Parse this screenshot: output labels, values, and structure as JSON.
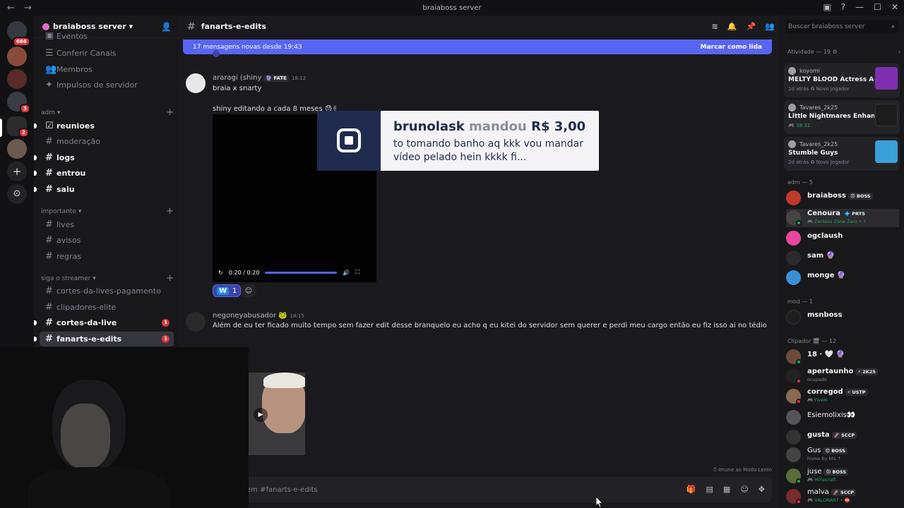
{
  "window": {
    "title": "braiaboss server",
    "back": "←",
    "forward": "→"
  },
  "guilds": {
    "home_badge": "666",
    "badges": [
      "3",
      "2"
    ],
    "add_icon": "+",
    "explore_icon": "⊙"
  },
  "server": {
    "name": "braiaboss server ▾"
  },
  "sidebar": {
    "top_items": [
      {
        "label": "Eventos",
        "icon": "▣"
      },
      {
        "label": "Conferir Canais",
        "icon": "☰"
      },
      {
        "label": "Membros",
        "icon": "👥"
      },
      {
        "label": "Impulsos de servidor",
        "icon": "✦"
      }
    ],
    "categories": [
      {
        "label": "adm ▾",
        "channels": [
          {
            "label": "reunioes",
            "icon": "☑",
            "bright": true
          },
          {
            "label": "moderação",
            "icon": "#",
            "bright": false
          },
          {
            "label": "logs",
            "icon": "#",
            "bright": true
          },
          {
            "label": "entrou",
            "icon": "#",
            "bright": true
          },
          {
            "label": "saiu",
            "icon": "#",
            "bright": true
          }
        ]
      },
      {
        "label": "importante ▾",
        "channels": [
          {
            "label": "lives",
            "icon": "#",
            "bright": false
          },
          {
            "label": "avisos",
            "icon": "#",
            "bright": false
          },
          {
            "label": "regras",
            "icon": "#",
            "bright": false
          }
        ]
      },
      {
        "label": "siga o streamer ▾",
        "channels": [
          {
            "label": "cortes-da-lives-pagamento",
            "icon": "#",
            "bright": false
          },
          {
            "label": "clipadores-elite",
            "icon": "#",
            "bright": false
          },
          {
            "label": "cortes-da-live",
            "icon": "#",
            "bright": true,
            "badge": "1"
          },
          {
            "label": "fanarts-e-edits",
            "icon": "#",
            "bright": true,
            "badge": "1",
            "active": true
          }
        ]
      }
    ]
  },
  "channel": {
    "name": "fanarts-e-edits",
    "hash": "#"
  },
  "banner": {
    "text": "17 mensagens novas desde 19:43",
    "mark": "Marcar como lida"
  },
  "messages": [
    {
      "author": "araragi (shiny",
      "tag": "🔮 FATE",
      "time": "18:12",
      "lines": [
        "braia x snarty",
        "shiny editando a cada 8 meses 😓✌"
      ],
      "video": {
        "time": "0:20 / 0:20",
        "progress": 1.0
      },
      "reaction": {
        "emoji": "W",
        "count": "1"
      }
    },
    {
      "author": "negoneyabusador",
      "tag": "🐸",
      "time": "18:15",
      "lines": [
        "Além de eu ter ficado muito tempo sem fazer edit desse branquelo eu acho q eu kitei do servidor sem querer e perdi meu cargo então eu fiz isso ai no tédio"
      ]
    }
  ],
  "donation": {
    "user": "brunolask",
    "verb": "mandou",
    "amount": "R$ 3,00",
    "message": "to tomando banho aq kkk vou mandar vídeo pelado hein kkkk fi..."
  },
  "input": {
    "placeholder": "em #fanarts-e-edits"
  },
  "immune": "Imune ao Modo Lento",
  "search": {
    "placeholder": "Buscar braiaboss server"
  },
  "activity": {
    "header": "Atividade — 19",
    "cards": [
      {
        "user": "koyomi",
        "game": "MELTY BLOOD Actress Ag...",
        "status": "1d atrás  ♻ Novo Jogador",
        "green": false,
        "art_color": "#7d2fb0"
      },
      {
        "user": "Tavares_2k25",
        "game": "Little Nightmares Enhance...",
        "status": "🎮 38:32",
        "green": true,
        "art_color": "#1c1c1c"
      },
      {
        "user": "Tavares_2k25",
        "game": "Stumble Guys",
        "status": "2d atrás  ♻ Novo Jogador",
        "green": false,
        "art_color": "#3aa0d8"
      }
    ]
  },
  "member_groups": [
    {
      "label": "adm — 5",
      "members": [
        {
          "name": "braiaboss",
          "tag": "😠 BOSS",
          "sub": "",
          "color": "#c0392b"
        },
        {
          "name": "Cenoura",
          "tag": "💠 PRTS",
          "sub": "🎮 Zenless Zone Zero • ⚡",
          "sub_green": true,
          "color": "#444"
        },
        {
          "name": "ogclaush",
          "tag": "",
          "sub": "",
          "color": "#eb459e"
        },
        {
          "name": "sam 🔮",
          "tag": "",
          "sub": "",
          "color": "#2b2b2b"
        },
        {
          "name": "monge 🔮",
          "tag": "",
          "sub": "",
          "color": "#3a8fd9"
        }
      ]
    },
    {
      "label": "mod — 1",
      "members": [
        {
          "name": "msnboss",
          "tag": "",
          "sub": "",
          "color": "#1e1e1e"
        }
      ]
    },
    {
      "label": "Clipador 🎬 — 12",
      "members": [
        {
          "name": "18 · 🤍 🔮",
          "tag": "",
          "sub": "",
          "color": "#6d4b3a"
        },
        {
          "name": "apertaunho",
          "tag": "⚡ 2K25",
          "sub": "ocupado",
          "color": "#222"
        },
        {
          "name": "corregod",
          "tag": "⚡ USTP",
          "sub": "🎮 FiveM",
          "sub_green": true,
          "color": "#8a6b52"
        },
        {
          "name": "Esiemolixis👀",
          "tag": "",
          "sub": "",
          "color": "#555"
        },
        {
          "name": "gusta",
          "tag": "🚀 SCCP",
          "sub": "",
          "color": "#333"
        },
        {
          "name": "Gus",
          "tag": "😠 BOSS",
          "sub": "home by bts ↑",
          "color": "#444"
        },
        {
          "name": "juse",
          "tag": "😠 BOSS",
          "sub": "🎮 Minecraft",
          "sub_green": true,
          "color": "#5b6c3a"
        },
        {
          "name": "malva",
          "tag": "🚀 SCCP",
          "sub": "🎮 VALORANT • ⛔",
          "sub_green": true,
          "color": "#7a2b2b"
        }
      ]
    }
  ],
  "colors": {
    "accent": "#5865f2",
    "danger": "#da373c",
    "online": "#23a55a"
  }
}
